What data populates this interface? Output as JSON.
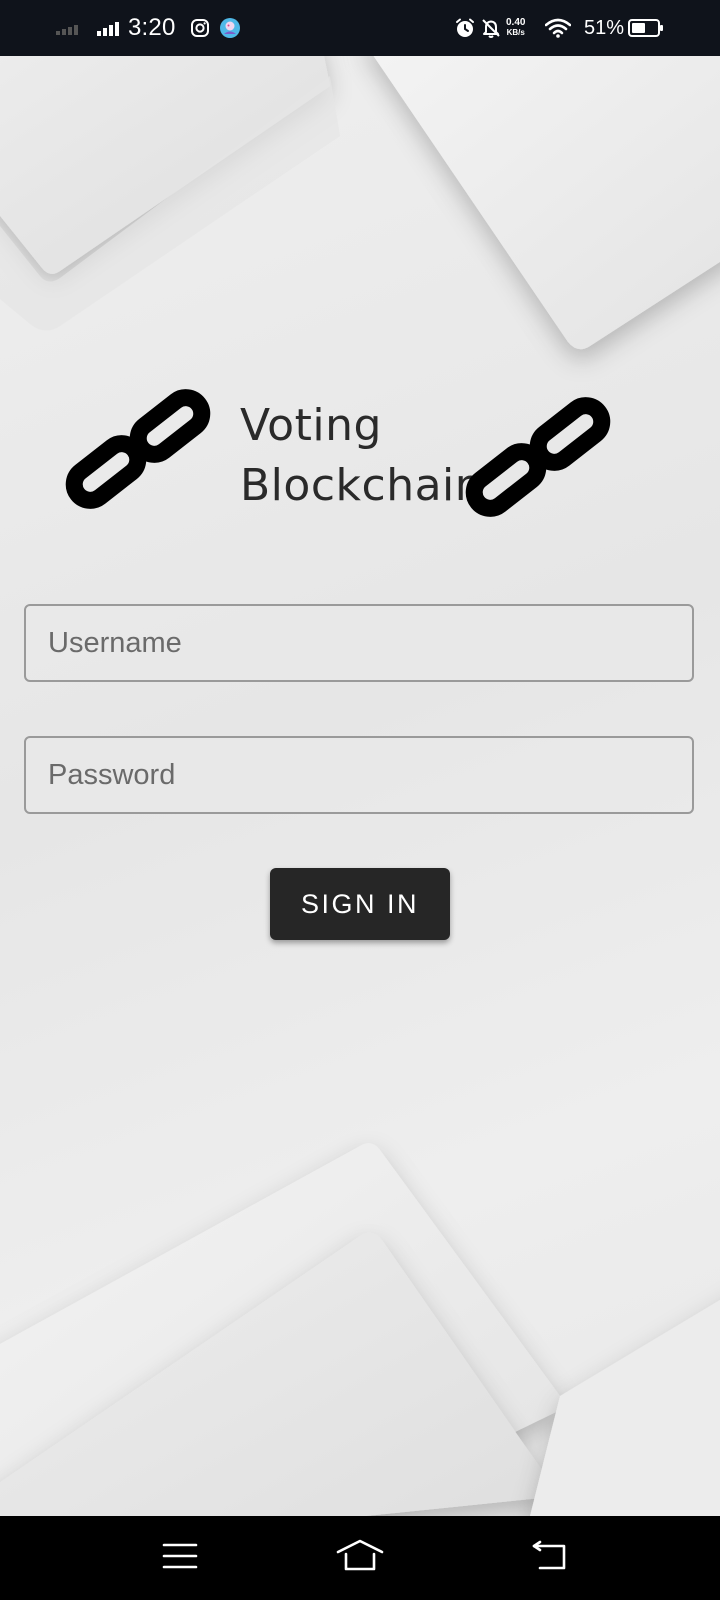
{
  "status_bar": {
    "time": "3:20",
    "net_speed_value": "0.40",
    "net_speed_unit": "KB/s",
    "battery_percent": "51%",
    "icons": [
      "signal-weak-icon",
      "signal-strong-icon",
      "instagram-icon",
      "app-notification-icon",
      "alarm-icon",
      "notifications-off-icon",
      "wifi-icon",
      "battery-icon"
    ]
  },
  "logo": {
    "line1": "Voting",
    "line2": "Blockchain",
    "icons": [
      "chain-link-icon",
      "chain-link-icon"
    ]
  },
  "form": {
    "username_placeholder": "Username",
    "username_value": "",
    "password_placeholder": "Password",
    "password_value": "",
    "signin_label": "SIGN IN"
  },
  "nav_bar": {
    "icons": [
      "menu-icon",
      "home-icon",
      "back-icon"
    ]
  },
  "colors": {
    "status_bar_bg": "#0f131b",
    "button_bg": "#262626",
    "field_border": "#9a9a9a",
    "nav_bar_bg": "#000000"
  }
}
